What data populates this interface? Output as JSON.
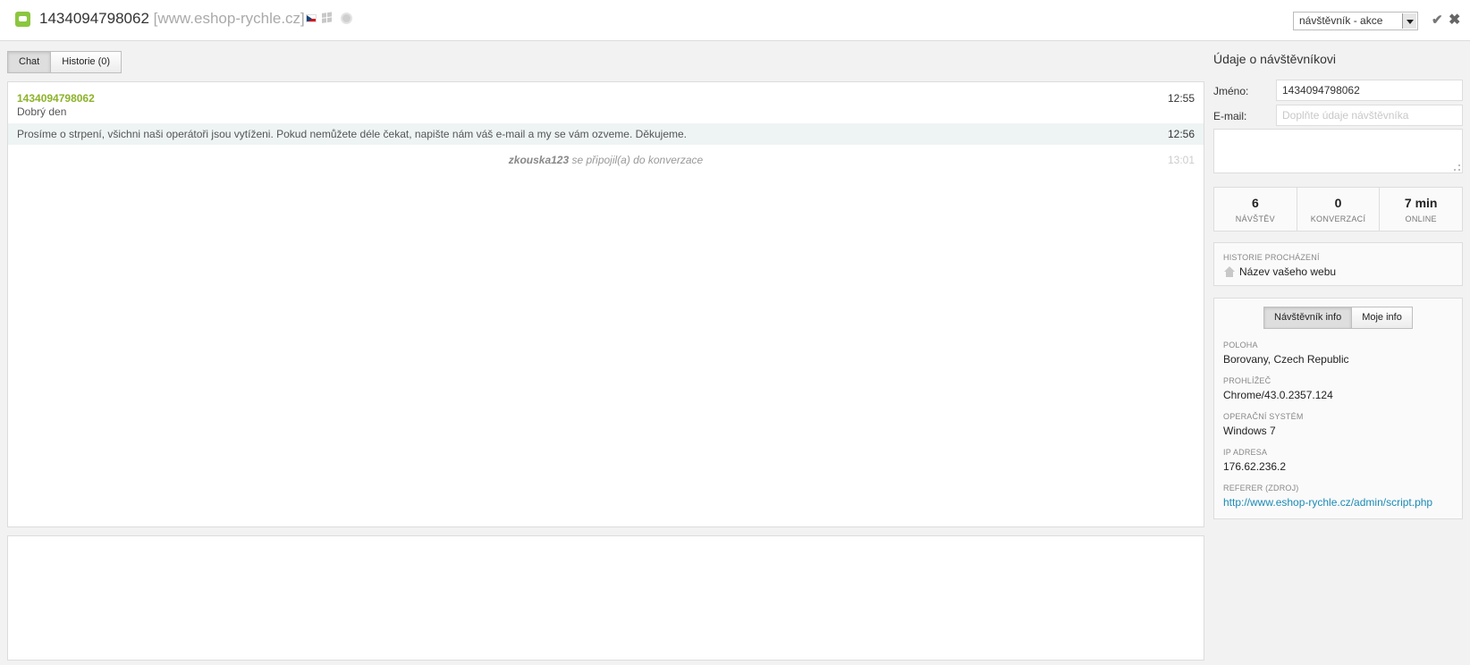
{
  "header": {
    "visitor_id": "1434094798062",
    "site": "[www.eshop-rychle.cz]",
    "action_select": "návštěvník - akce"
  },
  "tabs": [
    {
      "label": "Chat",
      "active": true
    },
    {
      "label": "Historie (0)",
      "active": false
    }
  ],
  "chat": {
    "messages": [
      {
        "name": "1434094798062",
        "text": "Dobrý den",
        "time": "12:55"
      },
      {
        "text": "Prosíme o strpení, všichni naši operátoři jsou vytíženi. Pokud nemůžete déle čekat, napište nám váš e-mail a my se vám ozveme. Děkujeme.",
        "time": "12:56"
      }
    ],
    "system": {
      "user": "zkouska123",
      "text": " se připojil(a) do konverzace",
      "time": "13:01"
    }
  },
  "sidebar": {
    "title": "Údaje o návštěvníkovi",
    "name_label": "Jméno:",
    "name_value": "1434094798062",
    "email_label": "E-mail:",
    "email_placeholder": "Doplňte údaje návštěvníka",
    "stats": [
      {
        "value": "6",
        "label": "NÁVŠTĚV"
      },
      {
        "value": "0",
        "label": "KONVERZACÍ"
      },
      {
        "value": "7 min",
        "label": "ONLINE"
      }
    ],
    "history_label": "HISTORIE PROCHÁZENÍ",
    "history_page": "Název vašeho webu",
    "info_tabs": [
      {
        "label": "Návštěvník info",
        "active": true
      },
      {
        "label": "Moje info",
        "active": false
      }
    ],
    "info": [
      {
        "label": "POLOHA",
        "value": "Borovany, Czech Republic"
      },
      {
        "label": "PROHLÍŽEČ",
        "value": "Chrome/43.0.2357.124"
      },
      {
        "label": "OPERAČNÍ SYSTÉM",
        "value": "Windows 7"
      },
      {
        "label": "IP ADRESA",
        "value": "176.62.236.2"
      },
      {
        "label": "REFERER (ZDROJ)",
        "value": "http://www.eshop-rychle.cz/admin/script.php"
      }
    ]
  },
  "colors": {
    "accent_green": "#8cb32a",
    "link_blue": "#1a8ab6",
    "highlight_row": "#eef4f4"
  }
}
